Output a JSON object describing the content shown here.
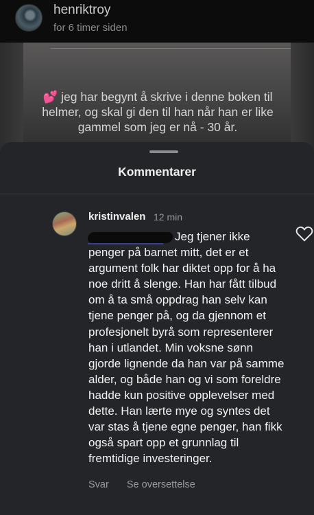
{
  "post": {
    "username": "henriktroy",
    "time": "for 6 timer siden"
  },
  "story": {
    "caption": "jeg har begynt å skrive i denne boken til helmer, og skal gi den til han når han er like gammel som jeg er nå - 30 år.",
    "caption_icon": "two-hearts-icon"
  },
  "sheet": {
    "title": "Kommentarer"
  },
  "comment": {
    "username": "kristinvalen",
    "time": "12 min",
    "text": "Jeg tjener ikke penger på barnet mitt, det er et argument folk har diktet opp for å ha noe dritt å slenge. Han har fått tilbud om å ta små oppdrag han selv kan tjene penger på, og da gjennom et profesjonelt byrå som representerer han i utlandet. Min voksne sønn gjorde lignende da han var på samme alder, og både han og vi som foreldre hadde kun positive opplevelser med dette. Han lærte mye og syntes det var stas å tjene egne penger, han fikk også spart opp et grunnlag til fremtidige investeringer.",
    "reply_label": "Svar",
    "translate_label": "Se oversettelse",
    "like_icon": "heart-outline-icon"
  }
}
